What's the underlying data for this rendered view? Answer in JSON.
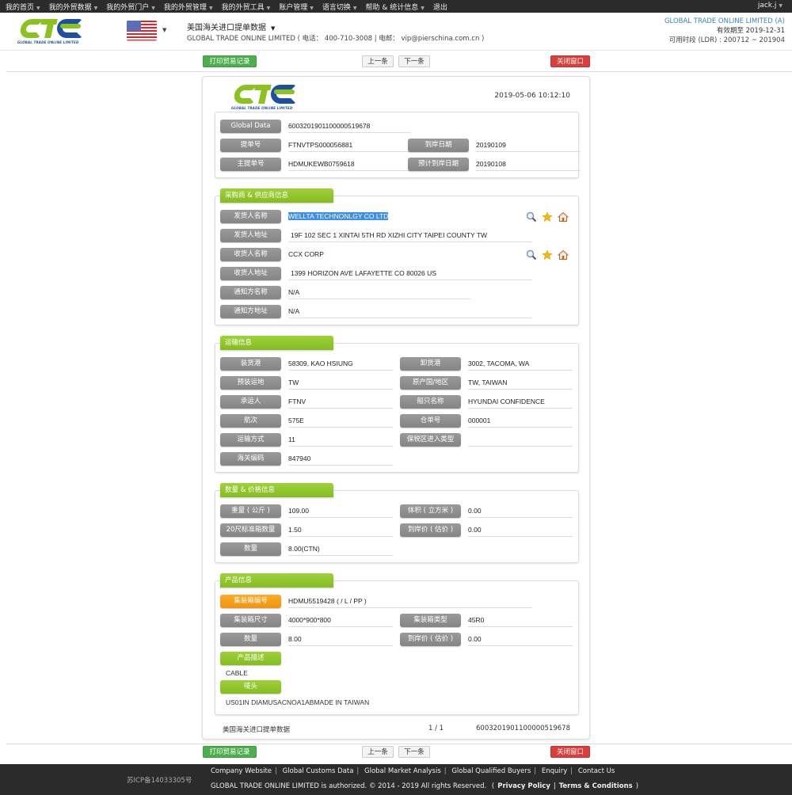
{
  "topnav": {
    "items": [
      "我的首页",
      "我的外贸数据",
      "我的外贸门户",
      "我的外贸管理",
      "我的外贸工具",
      "账户管理",
      "语言切换",
      "帮助 & 统计信息",
      "退出"
    ],
    "user": "jack.j"
  },
  "header": {
    "logo_tagline": "GLOBAL TRADE ONLINE LIMITED",
    "flag": "us-flag",
    "database_title": "美国海关进口提单数据",
    "company_line": "GLOBAL TRADE ONLINE LIMITED ( 电话： 400-710-3008 | 电邮： vip@pierschina.com.cn )",
    "account_company": "GLOBAL TRADE ONLINE LIMITED (A)",
    "expiry_label": "有效期至",
    "expiry_date": "2019-12-31",
    "ldr_label": "可用时段 (LDR) :",
    "ldr_range": "200712 ~ 201904"
  },
  "actions": {
    "print": "打印贸易记录",
    "prev": "上一条",
    "next": "下一条",
    "close": "关闭窗口"
  },
  "record": {
    "timestamp": "2019-05-06 10:12:10",
    "basic": {
      "global_data_label": "Global Data",
      "global_data": "6003201901100000519678",
      "bill_no_label": "提单号",
      "bill_no": "FTNVTPS000056881",
      "arrival_date_label": "到岸日期",
      "arrival_date": "20190109",
      "master_bill_label": "主提单号",
      "master_bill": "HDMUKEWB0759618",
      "est_arrival_label": "预计到岸日期",
      "est_arrival": "20190108"
    },
    "parties": {
      "title": "采购商 & 供应商信息",
      "shipper_name_label": "发货人名称",
      "shipper_name": "WELLTA TECHNONLGY CO LTD",
      "shipper_addr_label": "发货人地址",
      "shipper_addr": "19F 102 SEC 1 XINTAI 5TH RD XIZHI CITY TAIPEI COUNTY TW",
      "consignee_name_label": "收货人名称",
      "consignee_name": "CCX CORP",
      "consignee_addr_label": "收货人地址",
      "consignee_addr": "1399 HORIZON AVE LAFAYETTE CO 80026 US",
      "notify_name_label": "通知方名称",
      "notify_name": "N/A",
      "notify_addr_label": "通知方地址",
      "notify_addr": "N/A"
    },
    "transport": {
      "title": "运输信息",
      "loading_port_label": "装货港",
      "loading_port": "58309, KAO HSIUNG",
      "unloading_port_label": "卸货港",
      "unloading_port": "3002, TACOMA, WA",
      "pre_dest_label": "预装运地",
      "pre_dest": "TW",
      "origin_label": "原产国/地区",
      "origin": "TW, TAIWAN",
      "carrier_label": "承运人",
      "carrier": "FTNV",
      "vessel_label": "船只名称",
      "vessel": "HYUNDAI CONFIDENCE",
      "voyage_label": "航次",
      "voyage": "575E",
      "manifest_label": "仓单号",
      "manifest": "000001",
      "mode_label": "运输方式",
      "mode": "11",
      "bonded_label": "保税区进入类型",
      "bonded": "",
      "customs_code_label": "海关编码",
      "customs_code": "847940"
    },
    "quantity": {
      "title": "数量 & 价格信息",
      "weight_label": "重量 ( 公斤 )",
      "weight": "109.00",
      "volume_label": "体积 ( 立方米 )",
      "volume": "0.00",
      "teu_label": "20尺标准箱数量",
      "teu": "1.50",
      "price_label": "到岸价 ( 估价 )",
      "price": "0.00",
      "qty_label": "数量",
      "qty": "8.00(CTN)"
    },
    "product": {
      "title": "产品信息",
      "container_no_label": "集装箱编号",
      "container_no": "HDMU5519428 (  / L / PP )",
      "container_size_label": "集装箱尺寸",
      "container_size": "4000*900*800",
      "container_type_label": "集装箱类型",
      "container_type": "45R0",
      "qty_label": "数量",
      "qty": "8.00",
      "price_label": "到岸价 ( 估价 )",
      "price": "0.00",
      "desc_label": "产品描述",
      "desc": "CABLE",
      "marks_label": "唛头",
      "marks": "US01IN DIAMUSACNOA1ABMADE IN TAIWAN"
    },
    "footer": {
      "source": "美国海关进口提单数据",
      "page": "1 / 1",
      "id": "6003201901100000519678"
    }
  },
  "footer": {
    "icp": "苏ICP备14033305号",
    "links": [
      "Company Website",
      "Global Customs Data",
      "Global Market Analysis",
      "Global Qualified Buyers",
      "Enquiry",
      "Contact Us"
    ],
    "copyright": "GLOBAL TRADE ONLINE LIMITED is authorized. © 2014 - 2019 All rights Reserved.",
    "privacy": "Privacy Policy",
    "terms": "Terms & Conditions"
  }
}
